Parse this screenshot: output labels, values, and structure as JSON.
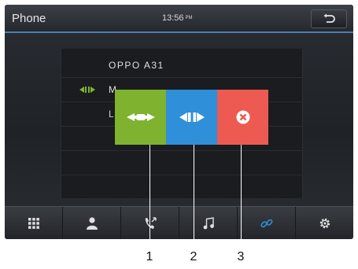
{
  "header": {
    "title": "Phone",
    "time": "13:56",
    "ampm": "PM"
  },
  "device_list": {
    "items": [
      {
        "label": "OPPO A31",
        "connected": false
      },
      {
        "label": "M",
        "connected": true
      },
      {
        "label": "L",
        "connected": false
      }
    ]
  },
  "popup": {
    "buttons": [
      {
        "icon": "connect-handshake-icon",
        "color": "#7eb22f"
      },
      {
        "icon": "disconnect-icon",
        "color": "#2f8fd8"
      },
      {
        "icon": "delete-icon",
        "color": "#ec5a52"
      }
    ]
  },
  "navbar": {
    "items": [
      {
        "icon": "keypad-icon"
      },
      {
        "icon": "contacts-icon"
      },
      {
        "icon": "call-log-icon"
      },
      {
        "icon": "music-icon"
      },
      {
        "icon": "link-icon",
        "active": true
      },
      {
        "icon": "settings-gear-icon"
      }
    ],
    "active_color": "#2f8fd8"
  },
  "callouts": {
    "labels": [
      "1",
      "2",
      "3"
    ]
  }
}
